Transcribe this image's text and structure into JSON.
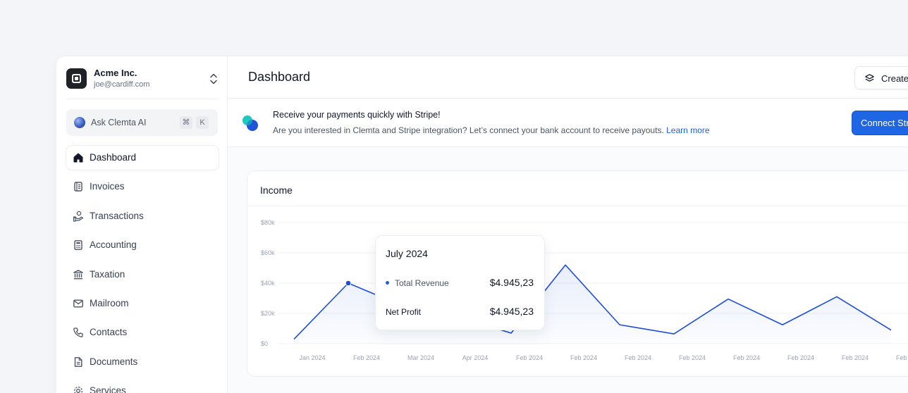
{
  "sidebar": {
    "org": {
      "name": "Acme Inc.",
      "email": "joe@cardiff.com"
    },
    "ask": {
      "label": "Ask Clemta AI",
      "key1": "⌘",
      "key2": "K"
    },
    "items": [
      {
        "label": "Dashboard",
        "icon": "home-icon",
        "active": true
      },
      {
        "label": "Invoices",
        "icon": "invoice-icon"
      },
      {
        "label": "Transactions",
        "icon": "transactions-icon"
      },
      {
        "label": "Accounting",
        "icon": "calculator-icon"
      },
      {
        "label": "Taxation",
        "icon": "bank-icon"
      },
      {
        "label": "Mailroom",
        "icon": "mail-icon"
      },
      {
        "label": "Contacts",
        "icon": "phone-icon"
      },
      {
        "label": "Documents",
        "icon": "document-icon"
      },
      {
        "label": "Services",
        "icon": "gear-icon"
      }
    ]
  },
  "header": {
    "title": "Dashboard",
    "create_label": "Create"
  },
  "banner": {
    "title": "Receive your payments quickly with Stripe!",
    "text": "Are you interested in Clemta and Stripe integration? Let’s connect your bank account to receive payouts.",
    "link": "Learn more",
    "button": "Connect Stripe"
  },
  "income": {
    "title": "Income",
    "tooltip": {
      "title": "July 2024",
      "revenue_label": "Total Revenue",
      "revenue_value": "$4.945,23",
      "profit_label": "Net Profit",
      "profit_value": "$4.945,23"
    }
  },
  "colors": {
    "accent": "#1f66e5",
    "line": "#1d4ed8"
  },
  "chart_data": {
    "type": "area",
    "title": "Income",
    "categories": [
      "Jan 2024",
      "Feb 2024",
      "Mar 2024",
      "Apr 2024",
      "Feb 2024",
      "Feb 2024",
      "Feb 2024",
      "Feb 2024",
      "Feb 2024",
      "Feb 2024",
      "Feb 2024",
      "Feb 2024"
    ],
    "series": [
      {
        "values": [
          3000,
          40000,
          25000,
          18000,
          7000,
          52000,
          12500,
          6500,
          29500,
          12500,
          31000,
          9000
        ]
      }
    ],
    "y_ticks": [
      "$0",
      "$20k",
      "$40k",
      "$60k",
      "$80k"
    ],
    "ylim": [
      0,
      80000
    ],
    "grid": true,
    "highlight_index": 1
  }
}
